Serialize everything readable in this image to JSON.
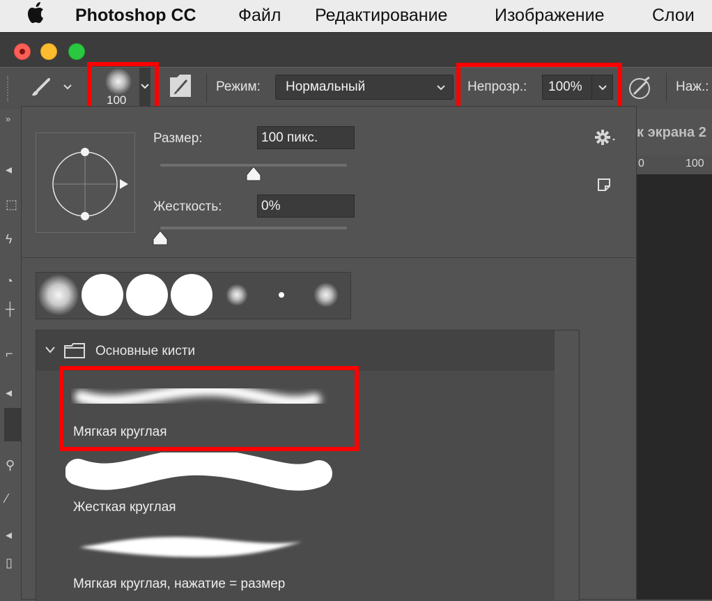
{
  "menubar": {
    "apple": "",
    "app": "Photoshop CC",
    "items": [
      "Файл",
      "Редактирование",
      "Изображение",
      "Слои"
    ]
  },
  "options": {
    "brush_size_value": "100",
    "mode_label": "Режим:",
    "mode_value": "Нормальный",
    "opacity_label": "Непрозр.:",
    "opacity_value": "100%",
    "flow_label_partial": "Наж.:"
  },
  "document": {
    "tab_title_partial": "к экрана 2",
    "ruler_labels": [
      "0",
      "100"
    ]
  },
  "picker": {
    "size_label": "Размер:",
    "size_value": "100 пикс.",
    "size_fraction": 0.5,
    "hardness_label": "Жесткость:",
    "hardness_value": "0%",
    "hardness_fraction": 0.0,
    "folder_name": "Основные кисти",
    "presets": [
      {
        "name": "Мягкая круглая",
        "highlighted": true
      },
      {
        "name": "Жесткая круглая",
        "highlighted": false
      },
      {
        "name": "Мягкая круглая, нажатие = размер",
        "highlighted": false
      }
    ]
  },
  "colors": {
    "highlight": "#ff0000",
    "panel_bg": "#535353",
    "field_bg": "#3b3b3b",
    "text": "#e4e4e4"
  }
}
